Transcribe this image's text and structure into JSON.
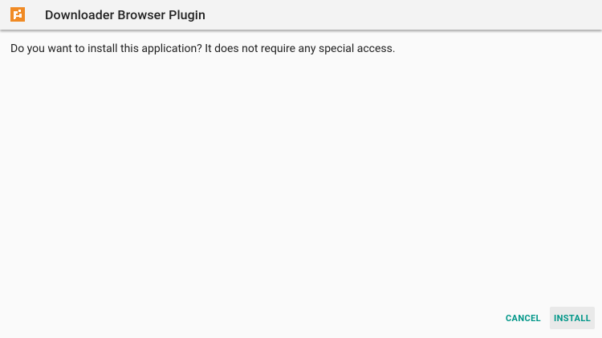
{
  "header": {
    "app_icon": "downloader-app-icon",
    "title": "Downloader Browser Plugin"
  },
  "dialog": {
    "message": "Do you want to install this application? It does not require any special access."
  },
  "actions": {
    "cancel_label": "CANCEL",
    "install_label": "INSTALL"
  },
  "colors": {
    "accent": "#009688",
    "icon": "#f08a24",
    "header_bg": "#f3f3f3",
    "page_bg": "#fafafa"
  }
}
